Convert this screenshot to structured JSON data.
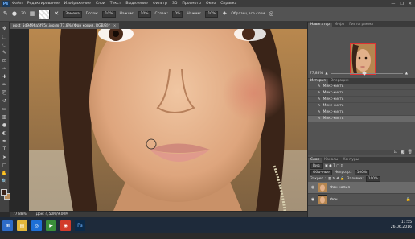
{
  "menu": {
    "logo": "Ps",
    "items": [
      "Файл",
      "Редактирование",
      "Изображение",
      "Слои",
      "Текст",
      "Выделение",
      "Фильтр",
      "3D",
      "Просмотр",
      "Окно",
      "Справка"
    ],
    "window_buttons": [
      "—",
      "❐",
      "✕"
    ]
  },
  "options_bar": {
    "brush_size": "30",
    "mode_label": "Режим:",
    "mode_value": "Замена",
    "flow_label": "Поток:",
    "flow_value": "10%",
    "pressure_label": "Нажим:",
    "pressure_value": "10%",
    "smooth_label": "Сглаж:",
    "smooth_value": "0%",
    "strength_label": "Нажим:",
    "strength_value": "10%",
    "sample_label": "Образец все слои"
  },
  "toolbar": {
    "tools": [
      "move-icon",
      "marquee-icon",
      "lasso-icon",
      "quick-select-icon",
      "crop-icon",
      "eyedropper-icon",
      "healing-icon",
      "brush-icon",
      "clone-icon",
      "history-brush-icon",
      "eraser-icon",
      "gradient-icon",
      "blur-icon",
      "dodge-icon",
      "pen-icon",
      "type-icon",
      "path-select-icon",
      "shape-icon",
      "hand-icon",
      "zoom-icon"
    ],
    "glyphs": [
      "✥",
      "⬚",
      "◌",
      "✎",
      "⊡",
      "✑",
      "✚",
      "✏",
      "⎘",
      "↺",
      "▭",
      "▥",
      "●",
      "◐",
      "✒",
      "T",
      "➤",
      "▢",
      "✋",
      "🔍"
    ],
    "foreground_color": "#3b2218",
    "background_color": "#b98c5a"
  },
  "document": {
    "tab_title": "post_5d9496a5f95c.jpg @ 77,8% (Фон копия, RGB/8)*",
    "tab_close": "×"
  },
  "statusbar": {
    "zoom": "77,88%",
    "doc_size": "Док: 4,50M/9,00M"
  },
  "navigator": {
    "tabs": [
      "Навигатор",
      "Инфо",
      "Гистограмма"
    ],
    "zoom": "77,88%"
  },
  "history": {
    "tabs": [
      "История",
      "Операции"
    ],
    "items": [
      "Микс-кисть",
      "Микс-кисть",
      "Микс-кисть",
      "Микс-кисть",
      "Микс-кисть",
      "Микс-кисть"
    ]
  },
  "layers": {
    "tabs": [
      "Слои",
      "Каналы",
      "Контуры"
    ],
    "kind_label": "Вид",
    "blend_mode": "Обычные",
    "opacity_label": "Непрозр.:",
    "opacity_value": "100%",
    "lock_label": "Закреп.:",
    "fill_label": "Заливка:",
    "fill_value": "100%",
    "items": [
      {
        "name": "Фон копия"
      },
      {
        "name": "Фон"
      }
    ]
  },
  "taskbar": {
    "time": "11:55",
    "date": "26.06.2016"
  }
}
